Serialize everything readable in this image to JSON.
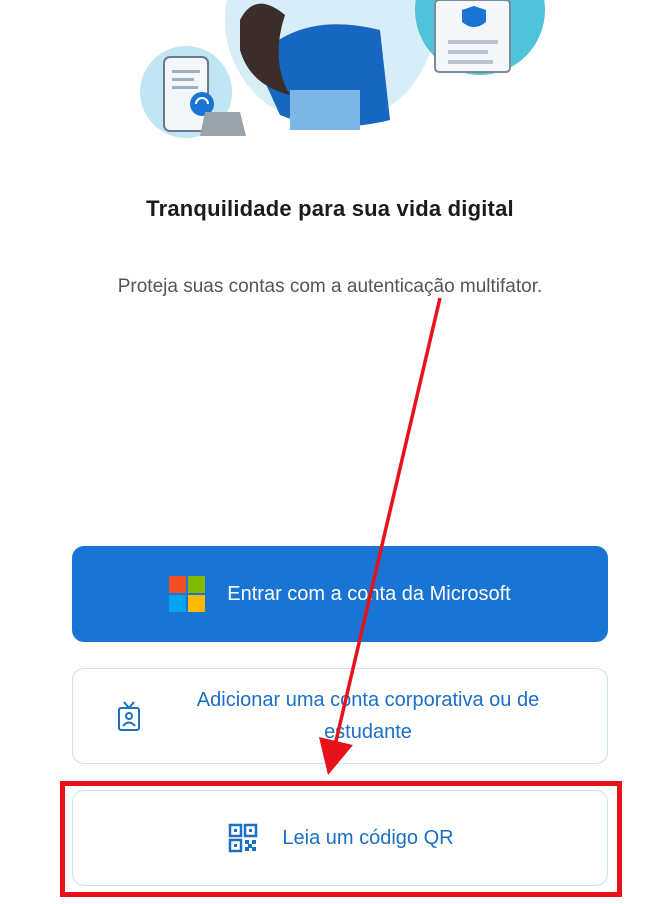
{
  "onboarding": {
    "title": "Tranquilidade para sua vida digital",
    "subtitle": "Proteja suas contas com a autenticação multifator."
  },
  "buttons": {
    "microsoft_label": "Entrar com a conta da Microsoft",
    "work_account_label": "Adicionar uma conta corporativa ou de estudante",
    "qr_label": "Leia um código QR"
  },
  "icons": {
    "microsoft": "microsoft-logo-icon",
    "work_account": "id-badge-icon",
    "qr": "qr-code-icon"
  },
  "colors": {
    "primary": "#1a74d3",
    "link_text": "#1a6fc7",
    "annotation": "#e8121a",
    "ms_red": "#f25022",
    "ms_green": "#7fba00",
    "ms_blue": "#00a4ef",
    "ms_yellow": "#ffb900"
  }
}
